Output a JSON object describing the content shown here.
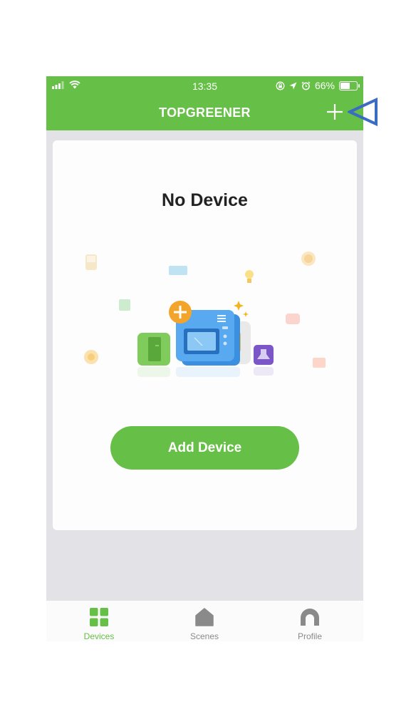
{
  "status_bar": {
    "time": "13:35",
    "battery_percent": "66%",
    "battery_level": 0.66
  },
  "header": {
    "title": "TOPGREENER",
    "add_icon": "plus-icon"
  },
  "empty_state": {
    "title": "No Device",
    "button_label": "Add Device"
  },
  "tabbar": {
    "tabs": [
      {
        "label": "Devices",
        "icon": "grid-icon",
        "active": true
      },
      {
        "label": "Scenes",
        "icon": "home-icon",
        "active": false
      },
      {
        "label": "Profile",
        "icon": "profile-icon",
        "active": false
      }
    ]
  },
  "colors": {
    "brand_green": "#66bf46",
    "background": "#e2e2e7",
    "inactive_tab": "#8a8a8a",
    "annotation_blue": "#3a6dc1"
  }
}
